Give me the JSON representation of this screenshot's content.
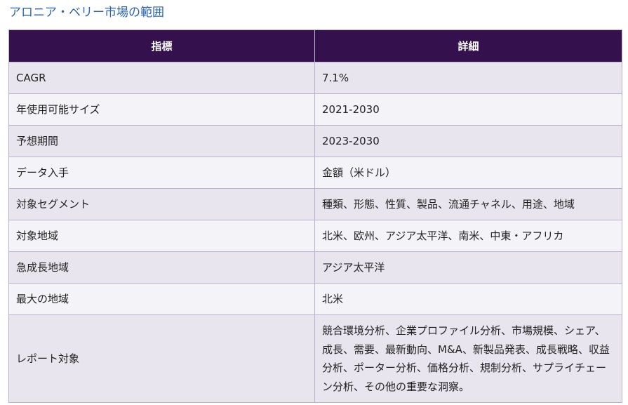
{
  "page": {
    "title": "アロニア・ベリー市場の範囲"
  },
  "table": {
    "headers": [
      "指標",
      "詳細"
    ],
    "rows": [
      [
        "CAGR",
        "7.1%"
      ],
      [
        "年使用可能サイズ",
        "2021-2030"
      ],
      [
        "予想期間",
        "2023-2030"
      ],
      [
        "データ入手",
        "金額（米ドル）"
      ],
      [
        "対象セグメント",
        "種類、形態、性質、製品、流通チャネル、用途、地域"
      ],
      [
        "対象地域",
        "北米、欧州、アジア太平洋、南米、中東・アフリカ"
      ],
      [
        "急成長地域",
        "アジア太平洋"
      ],
      [
        "最大の地域",
        "北米"
      ],
      [
        "レポート対象",
        "競合環境分析、企業プロファイル分析、市場規模、シェア、成長、需要、最新動向、M&A、新製品発表、成長戦略、収益分析、ポーター分析、価格分析、規制分析、サプライチェーン分析、その他の重要な洞察。"
      ]
    ]
  },
  "colors": {
    "header_bg": "#34114c",
    "title_color": "#2b64b4",
    "row_odd": "#e8e5ef",
    "row_even": "#f4f3f8"
  }
}
